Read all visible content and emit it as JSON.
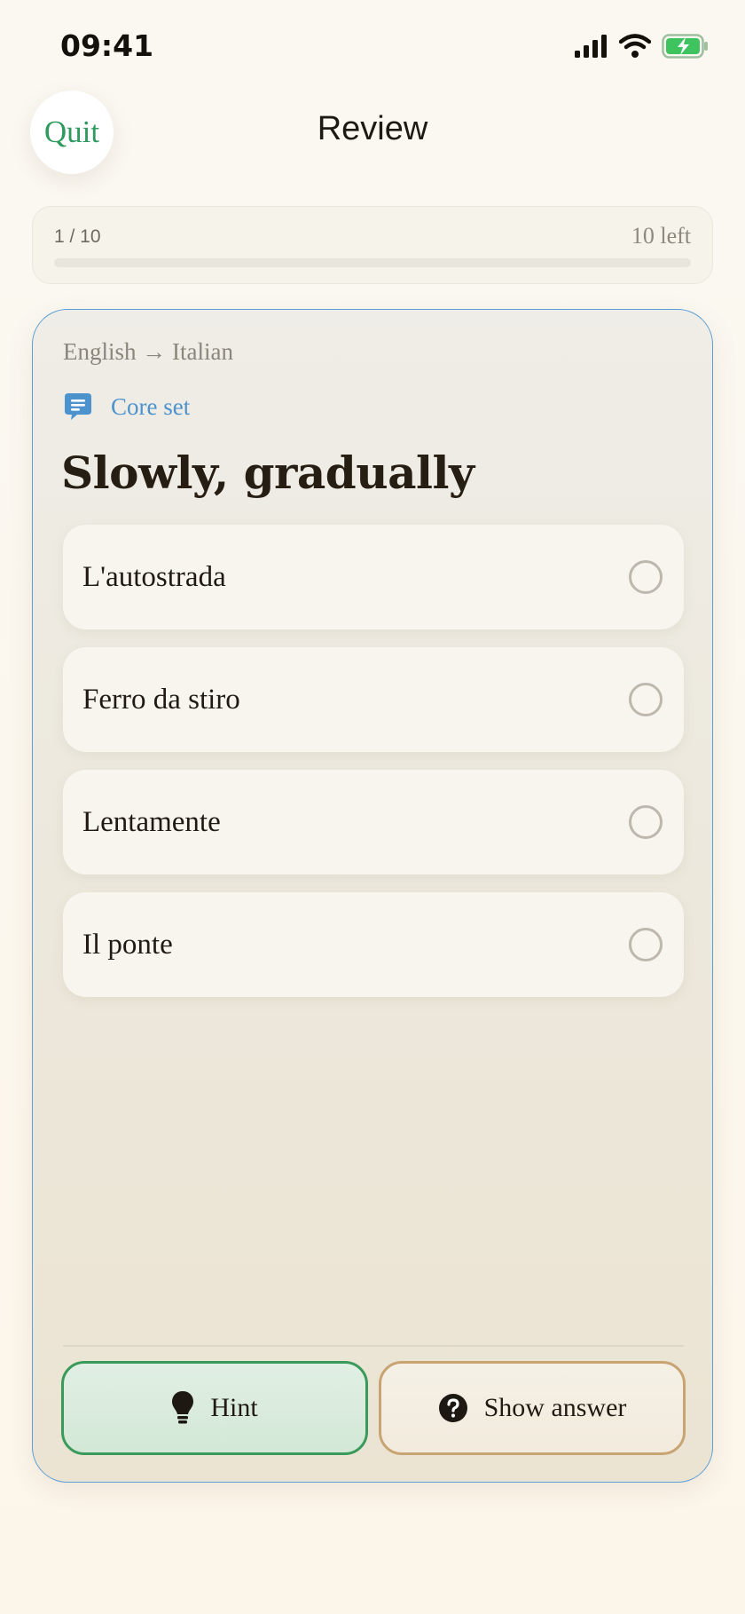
{
  "status_bar": {
    "time": "09:41"
  },
  "header": {
    "quit_label": "Quit",
    "title": "Review"
  },
  "progress": {
    "count": "1 / 10",
    "remaining": "10 left",
    "fraction": 0
  },
  "card": {
    "direction": "English → Italian",
    "set_label": "Core set",
    "prompt": "Slowly, gradually",
    "options": [
      {
        "label": "L'autostrada"
      },
      {
        "label": "Ferro da stiro"
      },
      {
        "label": "Lentamente"
      },
      {
        "label": "Il ponte"
      }
    ]
  },
  "actions": {
    "hint_label": "Hint",
    "show_answer_label": "Show answer"
  },
  "colors": {
    "accent_green": "#2f9a5e",
    "accent_blue": "#4c93ce",
    "accent_tan": "#c8a472"
  },
  "icons": {
    "status": [
      "signal-icon",
      "wifi-icon",
      "battery-charging-icon"
    ],
    "set": "message-icon",
    "hint": "lightbulb-icon",
    "answer": "question-icon"
  }
}
